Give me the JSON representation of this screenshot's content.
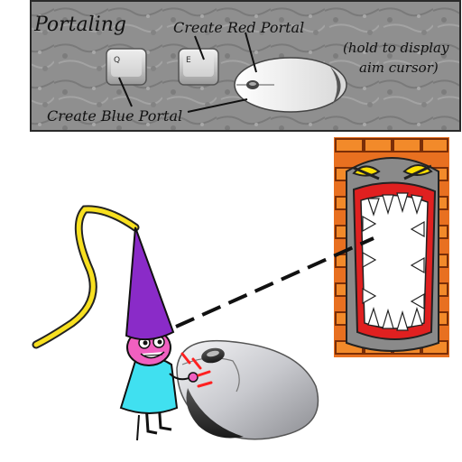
{
  "panel": {
    "title": "Portaling",
    "create_red_label": "Create Red Portal",
    "create_blue_label": "Create Blue Portal",
    "hold_hint_line1": "(hold to display",
    "hold_hint_line2": "aim cursor)"
  },
  "keys": {
    "q_key_label": "Q",
    "e_key_label": "E"
  },
  "colors": {
    "panel_stone": "#8f8f8f",
    "portal_orange": "#f07818",
    "hat_purple": "#8a2bc8",
    "skin_pink": "#f060c0",
    "dress_cyan": "#40e0f0",
    "hair_yellow": "#f8e020",
    "click_red": "#ff2020",
    "monster_red": "#e02020"
  },
  "icons": {
    "mouse": "computer-mouse-icon",
    "portal": "monster-mouth-portal"
  }
}
